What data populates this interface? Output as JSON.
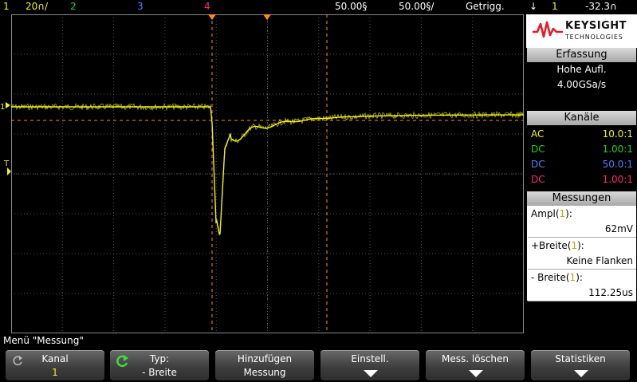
{
  "top_bar": {
    "ch1": "1",
    "ch1_scale": "20∩/",
    "ch2": "2",
    "ch3": "3",
    "ch4": "4",
    "timebase": "50.00§",
    "delay": "50.00§/",
    "trigger_mode": "Getrigg.",
    "trigger_icon": "↓",
    "trigger_source": "1",
    "trigger_level": "-32.3∩"
  },
  "brand": {
    "name": "KEYSIGHT",
    "sub": "TECHNOLOGIES"
  },
  "acquisition": {
    "header": "Erfassung",
    "mode": "Hohe Aufl.",
    "rate": "4.00GSa/s"
  },
  "channels": {
    "header": "Kanäle",
    "rows": [
      {
        "coupling": "AC",
        "probe": "10.0:1",
        "color": "#f2f21a"
      },
      {
        "coupling": "DC",
        "probe": "1.00:1",
        "color": "#1ed21e"
      },
      {
        "coupling": "DC",
        "probe": "50.0:1",
        "color": "#5a7dff"
      },
      {
        "coupling": "DC",
        "probe": "1.00:1",
        "color": "#ff2a78"
      }
    ]
  },
  "measurements": {
    "header": "Messungen",
    "items": [
      {
        "name": "Ampl(",
        "ch": "1",
        "close": "):",
        "value": "62mV"
      },
      {
        "name": "+Breite(",
        "ch": "1",
        "close": "):",
        "value": "Keine Flanken"
      },
      {
        "name": "- Breite(",
        "ch": "1",
        "close": "):",
        "value": "112.25us"
      }
    ]
  },
  "menu_title": "Menü \"Messung\"",
  "softkeys": [
    {
      "line1": "Kanal",
      "line2": "1",
      "icon": "back-icon"
    },
    {
      "line1": "Typ:",
      "line2": "- Breite",
      "icon": "rotate-knob-icon"
    },
    {
      "line1": "Hinzufügen",
      "line2": "Messung"
    },
    {
      "line1": "Einstell.",
      "icon": "submenu-arrow-icon"
    },
    {
      "line1": "Mess. löschen",
      "icon": "submenu-arrow-icon"
    },
    {
      "line1": "Statistiken",
      "icon": "submenu-arrow-icon"
    }
  ],
  "colors": {
    "ch1": "#f2f21a",
    "ch2": "#1ed21e",
    "ch3": "#5a7dff",
    "ch4": "#ff2a78",
    "cursor": "#ff8c1a",
    "grid": "#555555"
  },
  "waveform": {
    "channel": "1",
    "baseline_div": 1.0,
    "min_div": -1.0,
    "trigger_level_div": 0.2
  }
}
